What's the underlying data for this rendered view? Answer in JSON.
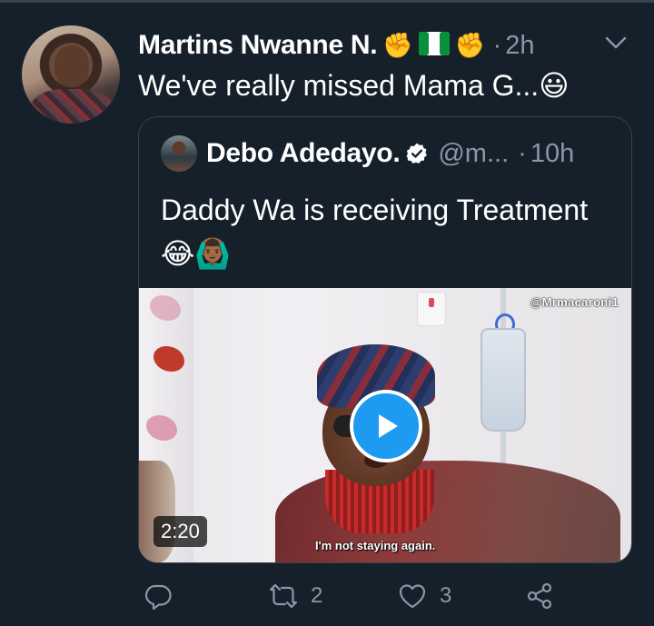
{
  "tweet": {
    "display_name": "Martins Nwanne N.",
    "name_emojis": [
      "✊",
      "🇳🇬",
      "✊"
    ],
    "separator": "·",
    "time": "2h",
    "text": "We've really missed Mama G...😃"
  },
  "quoted_tweet": {
    "display_name": "Debo Adedayo.",
    "handle": "@m...",
    "separator": "·",
    "time": "10h",
    "text": "Daddy Wa is receiving Treatment",
    "emojis": "😂🙆🏾‍♂️",
    "video": {
      "watermark": "@Mrmacaroni1",
      "subtitle": "I'm not staying again.",
      "duration": "2:20"
    }
  },
  "actions": {
    "reply_count": "",
    "retweet_count": "2",
    "like_count": "3"
  },
  "colors": {
    "background": "#15202b",
    "secondary_text": "#8899a6",
    "accent": "#1d9bf0",
    "border": "#38444d"
  }
}
